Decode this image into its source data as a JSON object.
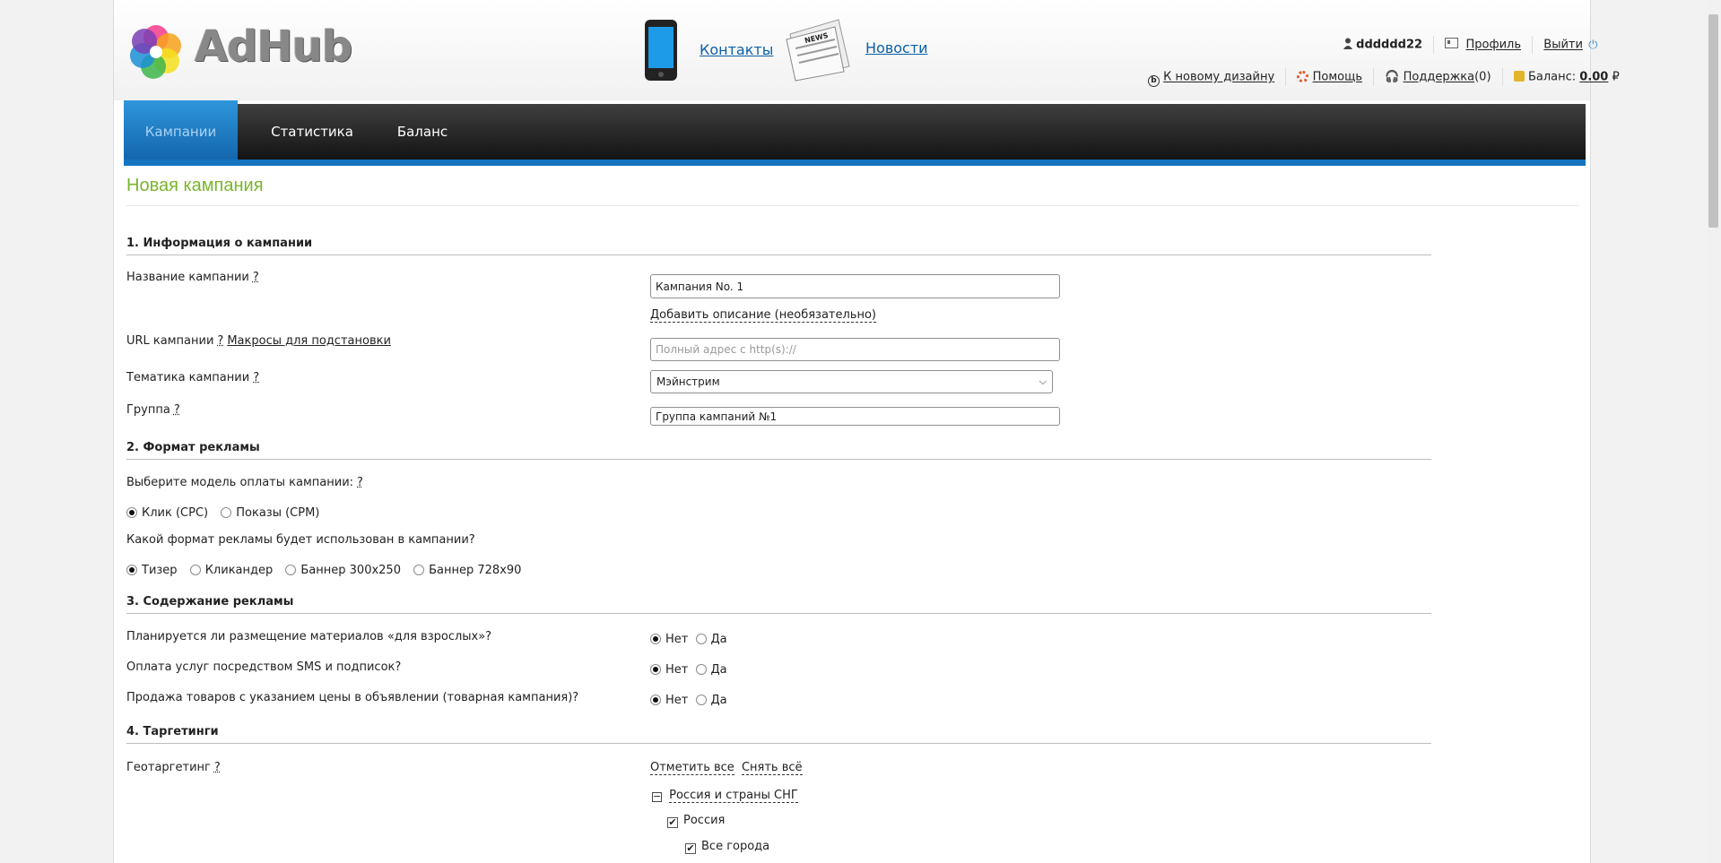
{
  "header": {
    "logo_text": "AdHub",
    "contacts": "Контакты",
    "news": "Новости",
    "news_icon_text": "NEWS",
    "username": "dddddd22",
    "profile": "Профиль",
    "logout": "Выйти",
    "new_design": "К новому дизайну",
    "help": "Помощь",
    "support": "Поддержка",
    "support_count": "(0)",
    "balance_label": "Баланс:",
    "balance_value": "0.00",
    "currency": "₽"
  },
  "nav": {
    "tabs": [
      {
        "label": "Кампании",
        "active": true
      },
      {
        "label": "Статистика",
        "active": false
      },
      {
        "label": "Баланс",
        "active": false
      }
    ]
  },
  "page_title": "Новая кампания",
  "section1": {
    "title": "1. Информация о кампании",
    "name_label": "Название кампании",
    "q": "?",
    "name_value": "Кампания No. 1",
    "add_description": "Добавить описание (необязательно)",
    "url_label": "URL кампании",
    "macros_link": "Макросы для подстановки",
    "url_placeholder": "Полный адрес с http(s)://",
    "topic_label": "Тематика кампании",
    "topic_value": "Мэйнстрим",
    "group_label": "Группа",
    "group_value": "Группа кампаний №1"
  },
  "section2": {
    "title": "2. Формат рекламы",
    "payment_label": "Выберите модель оплаты кампании:",
    "payment_options": [
      {
        "label": "Клик (CPC)",
        "selected": true
      },
      {
        "label": "Показы (CPM)",
        "selected": false
      }
    ],
    "format_label": "Какой формат рекламы будет использован в кампании?",
    "format_options": [
      {
        "label": "Тизер",
        "selected": true
      },
      {
        "label": "Кликандер",
        "selected": false
      },
      {
        "label": "Баннер 300x250",
        "selected": false
      },
      {
        "label": "Баннер 728x90",
        "selected": false
      }
    ]
  },
  "section3": {
    "title": "3. Содержание рекламы",
    "questions": [
      {
        "label": "Планируется ли размещение материалов «для взрослых»?",
        "no": "Нет",
        "yes": "Да"
      },
      {
        "label": "Оплата услуг посредством SMS и подписок?",
        "no": "Нет",
        "yes": "Да"
      },
      {
        "label": "Продажа товаров с указанием цены в объявлении (товарная кампания)?",
        "no": "Нет",
        "yes": "Да"
      }
    ]
  },
  "section4": {
    "title": "4. Таргетинги",
    "geo_label": "Геотаргетинг",
    "select_all": "Отметить все",
    "deselect_all": "Снять всё",
    "tree_root": "Россия и страны СНГ",
    "tree_russia": "Россия",
    "tree_all_cities": "Все города"
  }
}
